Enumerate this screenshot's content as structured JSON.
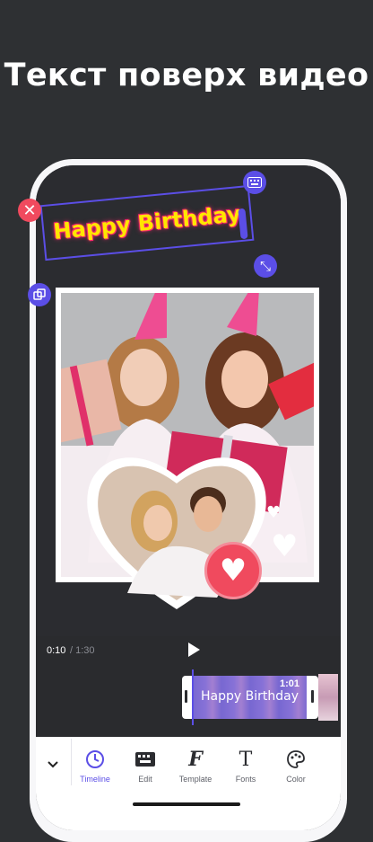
{
  "headline": "Текст поверх видео",
  "overlay_text": "Happy Birthday",
  "timeline": {
    "current": "0:10",
    "total": "/ 1:30",
    "clip_duration": "1:01",
    "clip_label": "Happy Birthday"
  },
  "toolbar": {
    "items": [
      {
        "label": "Timeline",
        "icon": "clock-icon",
        "active": true
      },
      {
        "label": "Edit",
        "icon": "keyboard-icon",
        "active": false
      },
      {
        "label": "Template",
        "icon": "font-f-icon",
        "active": false
      },
      {
        "label": "Fonts",
        "icon": "font-t-icon",
        "active": false
      },
      {
        "label": "Color",
        "icon": "palette-icon",
        "active": false
      }
    ]
  },
  "colors": {
    "background": "#2e3033",
    "accent": "#5b4ee6",
    "delete": "#f04a5e",
    "text_fill": "#ffe600",
    "text_glow": "#ff2a6d"
  }
}
